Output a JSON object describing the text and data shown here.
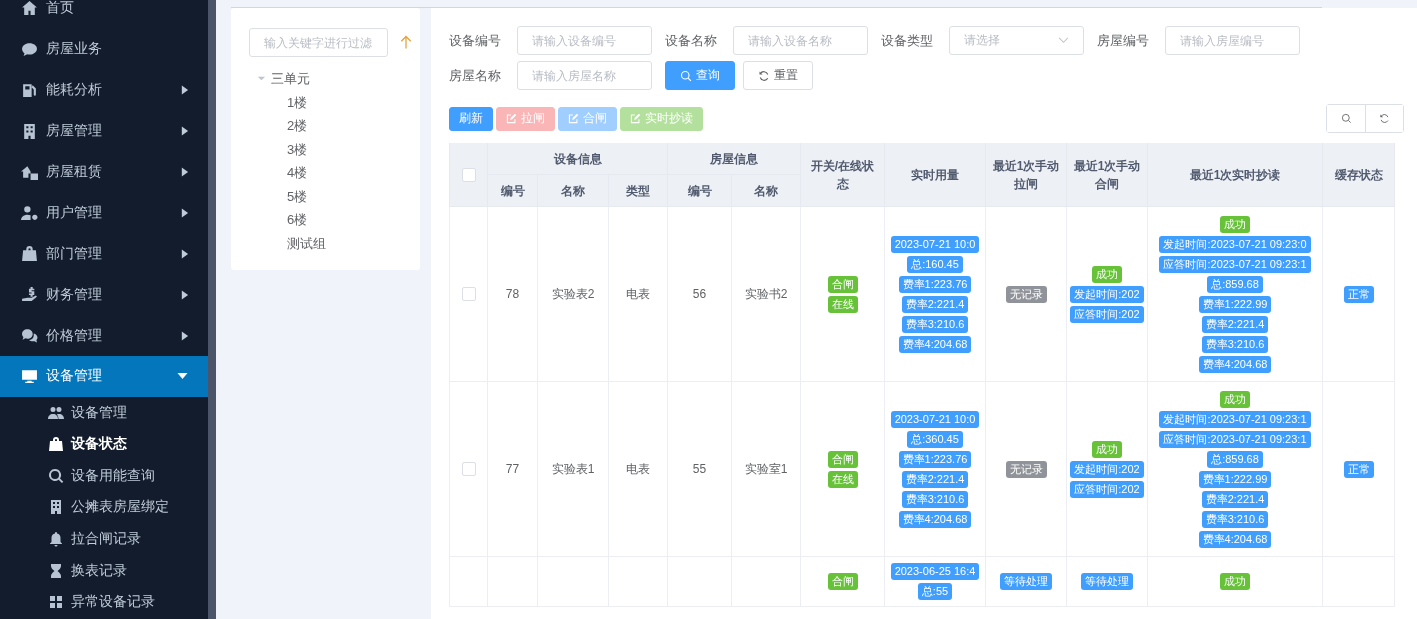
{
  "sidebar": {
    "items": [
      {
        "label": "首页",
        "kind": "link",
        "selected": false
      },
      {
        "label": "房屋业务",
        "kind": "link",
        "selected": false
      },
      {
        "label": "能耗分析",
        "kind": "group",
        "expanded": false,
        "selected": false
      },
      {
        "label": "房屋管理",
        "kind": "group",
        "expanded": false,
        "selected": false
      },
      {
        "label": "房屋租赁",
        "kind": "group",
        "expanded": false,
        "selected": false
      },
      {
        "label": "用户管理",
        "kind": "group",
        "expanded": false,
        "selected": false
      },
      {
        "label": "部门管理",
        "kind": "group",
        "expanded": false,
        "selected": false
      },
      {
        "label": "财务管理",
        "kind": "group",
        "expanded": false,
        "selected": false
      },
      {
        "label": "价格管理",
        "kind": "group",
        "expanded": false,
        "selected": false
      },
      {
        "label": "设备管理",
        "kind": "group",
        "expanded": true,
        "selected": true,
        "children": [
          {
            "label": "设备管理",
            "selected": false
          },
          {
            "label": "设备状态",
            "selected": true
          },
          {
            "label": "设备用能查询",
            "selected": false
          },
          {
            "label": "公摊表房屋绑定",
            "selected": false
          },
          {
            "label": "拉合闸记录",
            "selected": false
          },
          {
            "label": "换表记录",
            "selected": false
          },
          {
            "label": "异常设备记录",
            "selected": false
          }
        ]
      }
    ]
  },
  "tree": {
    "filter_placeholder": "输入关键字进行过滤",
    "nodes": [
      {
        "label": "三单元",
        "expanded": true,
        "children": [
          {
            "label": "1楼"
          },
          {
            "label": "2楼"
          },
          {
            "label": "3楼"
          },
          {
            "label": "4楼"
          },
          {
            "label": "5楼"
          },
          {
            "label": "6楼"
          },
          {
            "label": "测试组"
          }
        ]
      }
    ]
  },
  "filters": [
    {
      "label": "设备编号",
      "kind": "input",
      "placeholder": "请输入设备编号"
    },
    {
      "label": "设备名称",
      "kind": "input",
      "placeholder": "请输入设备名称"
    },
    {
      "label": "设备类型",
      "kind": "select",
      "placeholder": "请选择"
    },
    {
      "label": "房屋编号",
      "kind": "input",
      "placeholder": "请输入房屋编号"
    },
    {
      "label": "房屋名称",
      "kind": "input",
      "placeholder": "请输入房屋名称"
    }
  ],
  "filter_buttons": [
    {
      "label": "查询",
      "kind": "primary"
    },
    {
      "label": "重置",
      "kind": "default"
    }
  ],
  "toolbar": [
    {
      "label": "刷新",
      "kind": "primary",
      "disabled": false,
      "icon": false
    },
    {
      "label": "拉闸",
      "kind": "danger",
      "disabled": true,
      "icon": true
    },
    {
      "label": "合闸",
      "kind": "primary",
      "disabled": true,
      "icon": true
    },
    {
      "label": "实时抄读",
      "kind": "success",
      "disabled": true,
      "icon": true
    }
  ],
  "table": {
    "select_all": {
      "checked": false
    },
    "columns": [
      {
        "label": "设备信息",
        "children": [
          {
            "label": "编号"
          },
          {
            "label": "名称"
          },
          {
            "label": "类型"
          }
        ]
      },
      {
        "label": "房屋信息",
        "children": [
          {
            "label": "编号"
          },
          {
            "label": "名称"
          }
        ]
      },
      {
        "label": "开关/在线状态"
      },
      {
        "label": "实时用量"
      },
      {
        "label": "最近1次手动拉闸"
      },
      {
        "label": "最近1次手动合闸"
      },
      {
        "label": "最近1次实时抄读"
      },
      {
        "label": "缓存状态"
      }
    ],
    "rows": [
      {
        "checked": false,
        "device_no": "78",
        "device_name": "实验表2",
        "device_type": "电表",
        "house_no": "56",
        "house_name": "实验书2",
        "switch": [
          {
            "text": "合闸",
            "kind": "success"
          },
          {
            "text": "在线",
            "kind": "success"
          }
        ],
        "usage": [
          {
            "text": "2023-07-21 10:0",
            "kind": "primary"
          },
          {
            "text": "总:160.45",
            "kind": "primary"
          },
          {
            "text": "费率1:223.76",
            "kind": "primary"
          },
          {
            "text": "费率2:221.4",
            "kind": "primary"
          },
          {
            "text": "费率3:210.6",
            "kind": "primary"
          },
          {
            "text": "费率4:204.68",
            "kind": "primary"
          }
        ],
        "pull": [
          {
            "text": "无记录",
            "kind": "info"
          }
        ],
        "close": [
          {
            "text": "成功",
            "kind": "success"
          },
          {
            "text": "发起时间:202",
            "kind": "primary"
          },
          {
            "text": "应答时间:202",
            "kind": "primary"
          }
        ],
        "reading": [
          {
            "text": "成功",
            "kind": "success"
          },
          {
            "text": "发起时间:2023-07-21 09:23:0",
            "kind": "primary"
          },
          {
            "text": "应答时间:2023-07-21 09:23:1",
            "kind": "primary"
          },
          {
            "text": "总:859.68",
            "kind": "primary"
          },
          {
            "text": "费率1:222.99",
            "kind": "primary"
          },
          {
            "text": "费率2:221.4",
            "kind": "primary"
          },
          {
            "text": "费率3:210.6",
            "kind": "primary"
          },
          {
            "text": "费率4:204.68",
            "kind": "primary"
          }
        ],
        "cache": [
          {
            "text": "正常",
            "kind": "primary"
          }
        ]
      },
      {
        "checked": false,
        "device_no": "77",
        "device_name": "实验表1",
        "device_type": "电表",
        "house_no": "55",
        "house_name": "实验室1",
        "switch": [
          {
            "text": "合闸",
            "kind": "success"
          },
          {
            "text": "在线",
            "kind": "success"
          }
        ],
        "usage": [
          {
            "text": "2023-07-21 10:0",
            "kind": "primary"
          },
          {
            "text": "总:360.45",
            "kind": "primary"
          },
          {
            "text": "费率1:223.76",
            "kind": "primary"
          },
          {
            "text": "费率2:221.4",
            "kind": "primary"
          },
          {
            "text": "费率3:210.6",
            "kind": "primary"
          },
          {
            "text": "费率4:204.68",
            "kind": "primary"
          }
        ],
        "pull": [
          {
            "text": "无记录",
            "kind": "info"
          }
        ],
        "close": [
          {
            "text": "成功",
            "kind": "success"
          },
          {
            "text": "发起时间:202",
            "kind": "primary"
          },
          {
            "text": "应答时间:202",
            "kind": "primary"
          }
        ],
        "reading": [
          {
            "text": "成功",
            "kind": "success"
          },
          {
            "text": "发起时间:2023-07-21 09:23:1",
            "kind": "primary"
          },
          {
            "text": "应答时间:2023-07-21 09:23:1",
            "kind": "primary"
          },
          {
            "text": "总:859.68",
            "kind": "primary"
          },
          {
            "text": "费率1:222.99",
            "kind": "primary"
          },
          {
            "text": "费率2:221.4",
            "kind": "primary"
          },
          {
            "text": "费率3:210.6",
            "kind": "primary"
          },
          {
            "text": "费率4:204.68",
            "kind": "primary"
          }
        ],
        "cache": [
          {
            "text": "正常",
            "kind": "primary"
          }
        ]
      },
      {
        "switch": [
          {
            "text": "合闸",
            "kind": "success"
          }
        ],
        "usage": [
          {
            "text": "2023-06-25 16:4",
            "kind": "primary"
          },
          {
            "text": "总:55",
            "kind": "primary"
          }
        ],
        "pull": [
          {
            "text": "等待处理",
            "kind": "primary"
          }
        ],
        "close": [
          {
            "text": "等待处理",
            "kind": "primary"
          }
        ],
        "reading": [
          {
            "text": "成功",
            "kind": "success"
          }
        ]
      }
    ]
  }
}
